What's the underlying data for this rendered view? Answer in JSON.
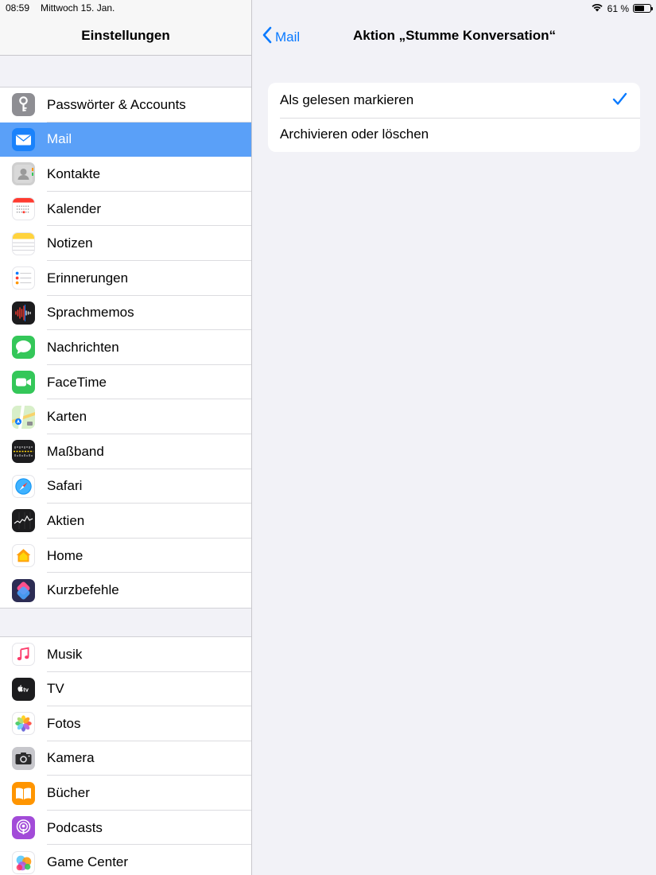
{
  "status": {
    "time": "08:59",
    "date": "Mittwoch 15. Jan.",
    "battery": "61 %",
    "battery_level": 0.61
  },
  "sidebar": {
    "title": "Einstellungen",
    "group1": [
      {
        "label": "Passwörter & Accounts",
        "icon": "key-icon",
        "color": "#8e8e93"
      },
      {
        "label": "Mail",
        "icon": "mail-icon",
        "color": "#1a82fb",
        "selected": true
      },
      {
        "label": "Kontakte",
        "icon": "contacts-icon",
        "color": "#bdbdbd"
      },
      {
        "label": "Kalender",
        "icon": "calendar-icon",
        "color": "#ffffff"
      },
      {
        "label": "Notizen",
        "icon": "notes-icon",
        "color": "#ffd33d"
      },
      {
        "label": "Erinnerungen",
        "icon": "reminders-icon",
        "color": "#ffffff"
      },
      {
        "label": "Sprachmemos",
        "icon": "voice-memos-icon",
        "color": "#1c1c1e"
      },
      {
        "label": "Nachrichten",
        "icon": "messages-icon",
        "color": "#34c759"
      },
      {
        "label": "FaceTime",
        "icon": "facetime-icon",
        "color": "#34c759"
      },
      {
        "label": "Karten",
        "icon": "maps-icon",
        "color": "#e9f5e1"
      },
      {
        "label": "Maßband",
        "icon": "measure-icon",
        "color": "#1c1c1e"
      },
      {
        "label": "Safari",
        "icon": "safari-icon",
        "color": "#ffffff"
      },
      {
        "label": "Aktien",
        "icon": "stocks-icon",
        "color": "#1c1c1e"
      },
      {
        "label": "Home",
        "icon": "home-icon",
        "color": "#ffffff"
      },
      {
        "label": "Kurzbefehle",
        "icon": "shortcuts-icon",
        "color": "#2c2c54"
      }
    ],
    "group2": [
      {
        "label": "Musik",
        "icon": "music-icon",
        "color": "#ffffff"
      },
      {
        "label": "TV",
        "icon": "tv-icon",
        "color": "#1c1c1e"
      },
      {
        "label": "Fotos",
        "icon": "photos-icon",
        "color": "#ffffff"
      },
      {
        "label": "Kamera",
        "icon": "camera-icon",
        "color": "#c7c7cc"
      },
      {
        "label": "Bücher",
        "icon": "books-icon",
        "color": "#ff9500"
      },
      {
        "label": "Podcasts",
        "icon": "podcasts-icon",
        "color": "#a24bd8"
      },
      {
        "label": "Game Center",
        "icon": "game-center-icon",
        "color": "#ffffff"
      }
    ]
  },
  "detail": {
    "back_label": "Mail",
    "title": "Aktion „Stumme Konversation“",
    "options": [
      {
        "label": "Als gelesen markieren",
        "checked": true
      },
      {
        "label": "Archivieren oder löschen",
        "checked": false
      }
    ]
  },
  "colors": {
    "accent": "#0a7aff",
    "selected_row": "#5aa0f8"
  }
}
